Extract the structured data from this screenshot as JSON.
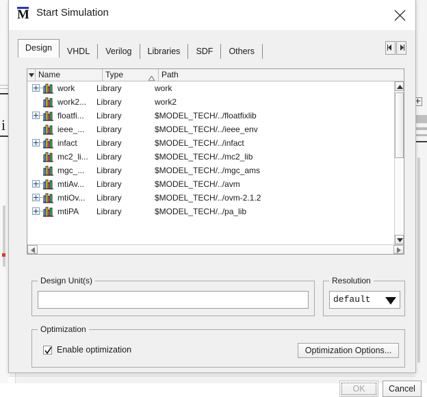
{
  "window": {
    "title": "Start Simulation",
    "icon": "modelsim-m-logo",
    "close_icon": "close-icon"
  },
  "tabs": {
    "items": [
      {
        "label": "Design",
        "active": true
      },
      {
        "label": "VHDL",
        "active": false
      },
      {
        "label": "Verilog",
        "active": false
      },
      {
        "label": "Libraries",
        "active": false
      },
      {
        "label": "SDF",
        "active": false
      },
      {
        "label": "Others",
        "active": false
      }
    ],
    "nav_prev_icon": "scroll-left-icon",
    "nav_next_icon": "scroll-right-icon"
  },
  "library_list": {
    "columns": [
      "Name",
      "Type",
      "Path"
    ],
    "header_dropdown_icon": "column-menu-icon",
    "sort_indicator_icon": "sort-ascending-icon",
    "sort_column": "Type",
    "rows": [
      {
        "expandable": true,
        "icon": "library-icon",
        "name": "work",
        "type": "Library",
        "path": "work"
      },
      {
        "expandable": false,
        "icon": "library-icon",
        "name": "work2...",
        "type": "Library",
        "path": "work2"
      },
      {
        "expandable": true,
        "icon": "library-icon",
        "name": "floatfi...",
        "type": "Library",
        "path": "$MODEL_TECH/../floatfixlib"
      },
      {
        "expandable": false,
        "icon": "library-icon",
        "name": "ieee_...",
        "type": "Library",
        "path": "$MODEL_TECH/../ieee_env"
      },
      {
        "expandable": true,
        "icon": "library-icon",
        "name": "infact",
        "type": "Library",
        "path": "$MODEL_TECH/../infact"
      },
      {
        "expandable": false,
        "icon": "library-icon",
        "name": "mc2_li...",
        "type": "Library",
        "path": "$MODEL_TECH/../mc2_lib"
      },
      {
        "expandable": false,
        "icon": "library-icon",
        "name": "mgc_...",
        "type": "Library",
        "path": "$MODEL_TECH/../mgc_ams"
      },
      {
        "expandable": true,
        "icon": "library-icon",
        "name": "mtiAv...",
        "type": "Library",
        "path": "$MODEL_TECH/../avm"
      },
      {
        "expandable": true,
        "icon": "library-icon",
        "name": "mtiOv...",
        "type": "Library",
        "path": "$MODEL_TECH/../ovm-2.1.2"
      },
      {
        "expandable": true,
        "icon": "library-icon",
        "name": "mtiPA",
        "type": "Library",
        "path": "$MODEL_TECH/../pa_lib"
      }
    ],
    "vscroll_up_icon": "scroll-up-icon",
    "vscroll_down_icon": "scroll-down-icon",
    "hscroll_left_icon": "scroll-left-icon",
    "hscroll_right_icon": "scroll-right-icon"
  },
  "design_units": {
    "title": "Design Unit(s)",
    "value": "",
    "placeholder": ""
  },
  "resolution": {
    "title": "Resolution",
    "value": "default",
    "arrow_icon": "chevron-down-icon"
  },
  "optimization": {
    "title": "Optimization",
    "enable_label": "Enable optimization",
    "enabled": true,
    "check_icon": "checkmark-icon",
    "options_button": "Optimization Options..."
  },
  "footer": {
    "ok_label": "OK",
    "ok_enabled": false,
    "cancel_label": "Cancel"
  }
}
